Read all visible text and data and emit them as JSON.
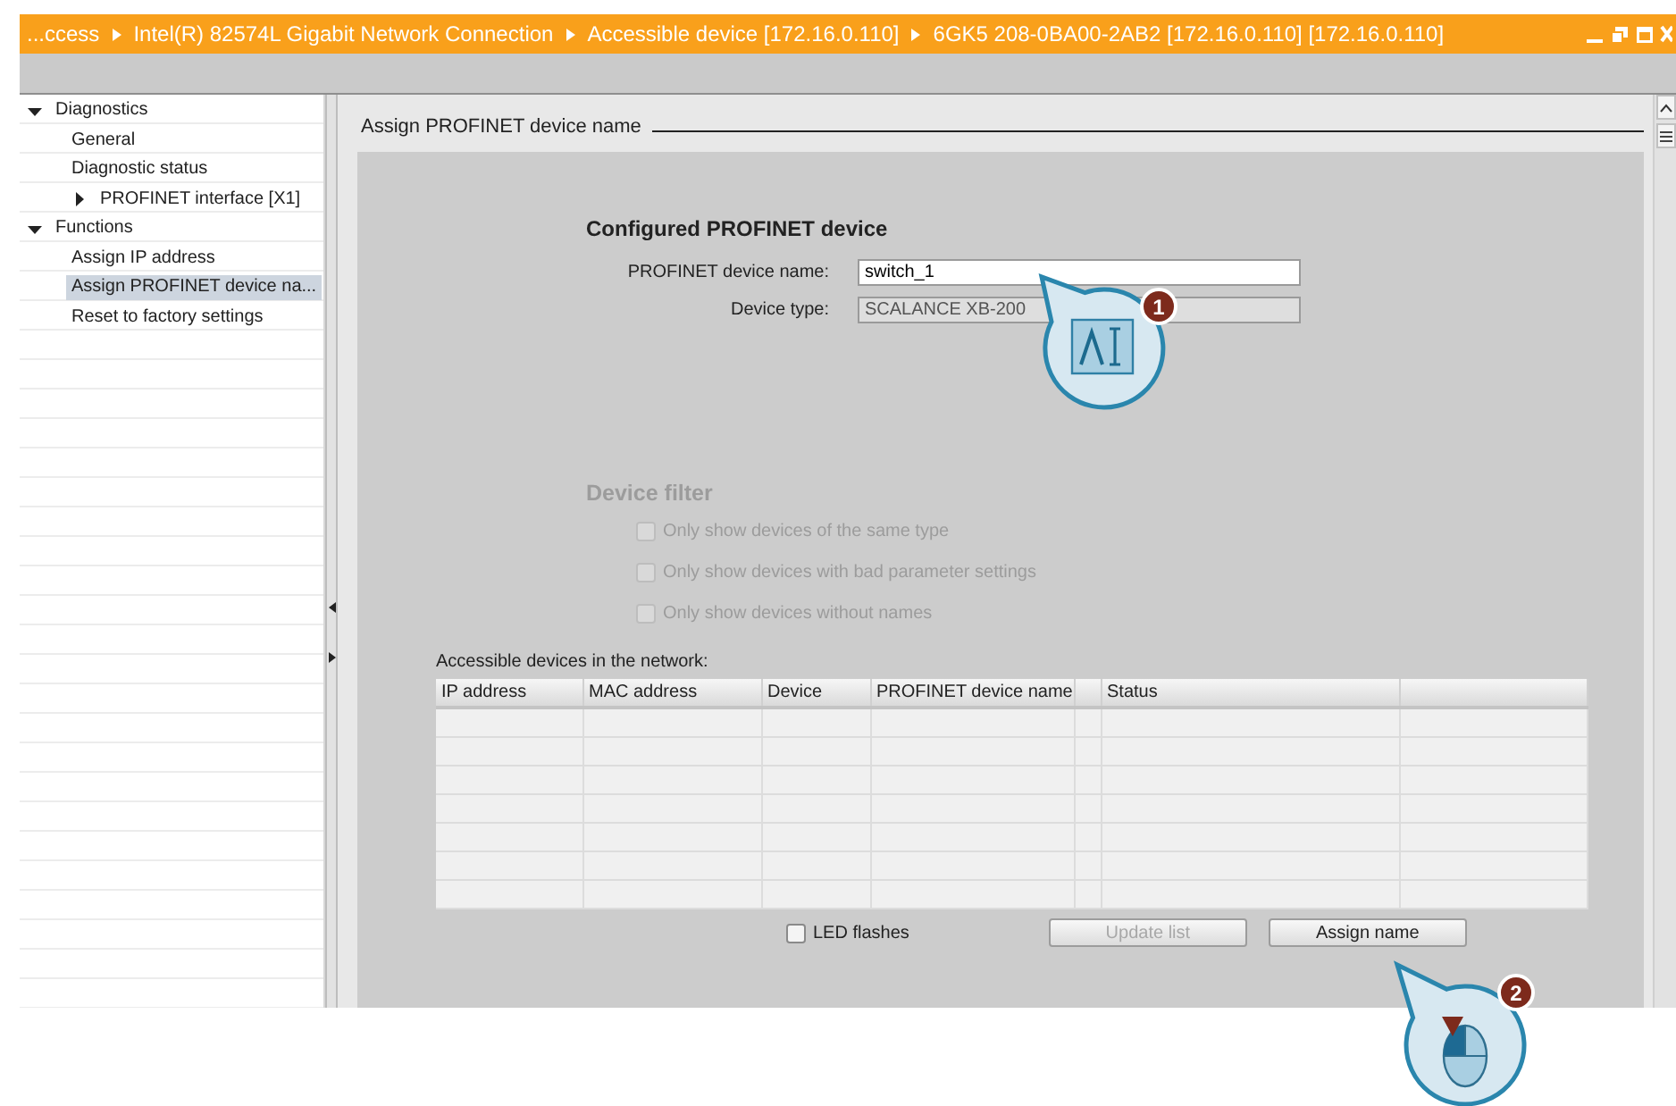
{
  "title_bar": {
    "breadcrumb": [
      "...ccess",
      "Intel(R) 82574L Gigabit Network Connection",
      "Accessible device [172.16.0.110]",
      "6GK5 208-0BA00-2AB2 [172.16.0.110] [172.16.0.110]"
    ]
  },
  "sidebar": {
    "items": [
      {
        "label": "Diagnostics",
        "expanded": true,
        "selected": false,
        "children": [
          {
            "label": "General",
            "selected": false
          },
          {
            "label": "Diagnostic status",
            "selected": false
          },
          {
            "label": "PROFINET interface [X1]",
            "selected": false,
            "expanded": false
          }
        ]
      },
      {
        "label": "Functions",
        "expanded": true,
        "selected": false,
        "children": [
          {
            "label": "Assign IP address",
            "selected": false
          },
          {
            "label": "Assign PROFINET device na...",
            "selected": true
          },
          {
            "label": "Reset to factory settings",
            "selected": false
          }
        ]
      }
    ]
  },
  "section_title": "Assign PROFINET device name",
  "configured_device": {
    "heading": "Configured PROFINET device",
    "fields": [
      {
        "label": "PROFINET device name:",
        "value": "switch_1",
        "disabled": false
      },
      {
        "label": "Device type:",
        "value": "SCALANCE XB-200",
        "disabled": true
      }
    ]
  },
  "device_filter": {
    "heading": "Device filter",
    "disabled": true,
    "options": [
      {
        "label": "Only show devices of the same type",
        "checked": false
      },
      {
        "label": "Only show devices with bad parameter settings",
        "checked": false
      },
      {
        "label": "Only show devices without names",
        "checked": false
      }
    ]
  },
  "device_list": {
    "caption": "Accessible devices in the network:",
    "columns": [
      "IP address",
      "MAC address",
      "Device",
      "PROFINET device name",
      "Status"
    ]
  },
  "footer": {
    "led_flashes": {
      "label": "LED flashes",
      "checked": false
    },
    "buttons": [
      {
        "label": "Update list",
        "disabled": true
      },
      {
        "label": "Assign name",
        "disabled": false
      }
    ]
  },
  "callouts": [
    {
      "number": "1",
      "kind": "text-cursor"
    },
    {
      "number": "2",
      "kind": "mouse-click"
    }
  ]
}
